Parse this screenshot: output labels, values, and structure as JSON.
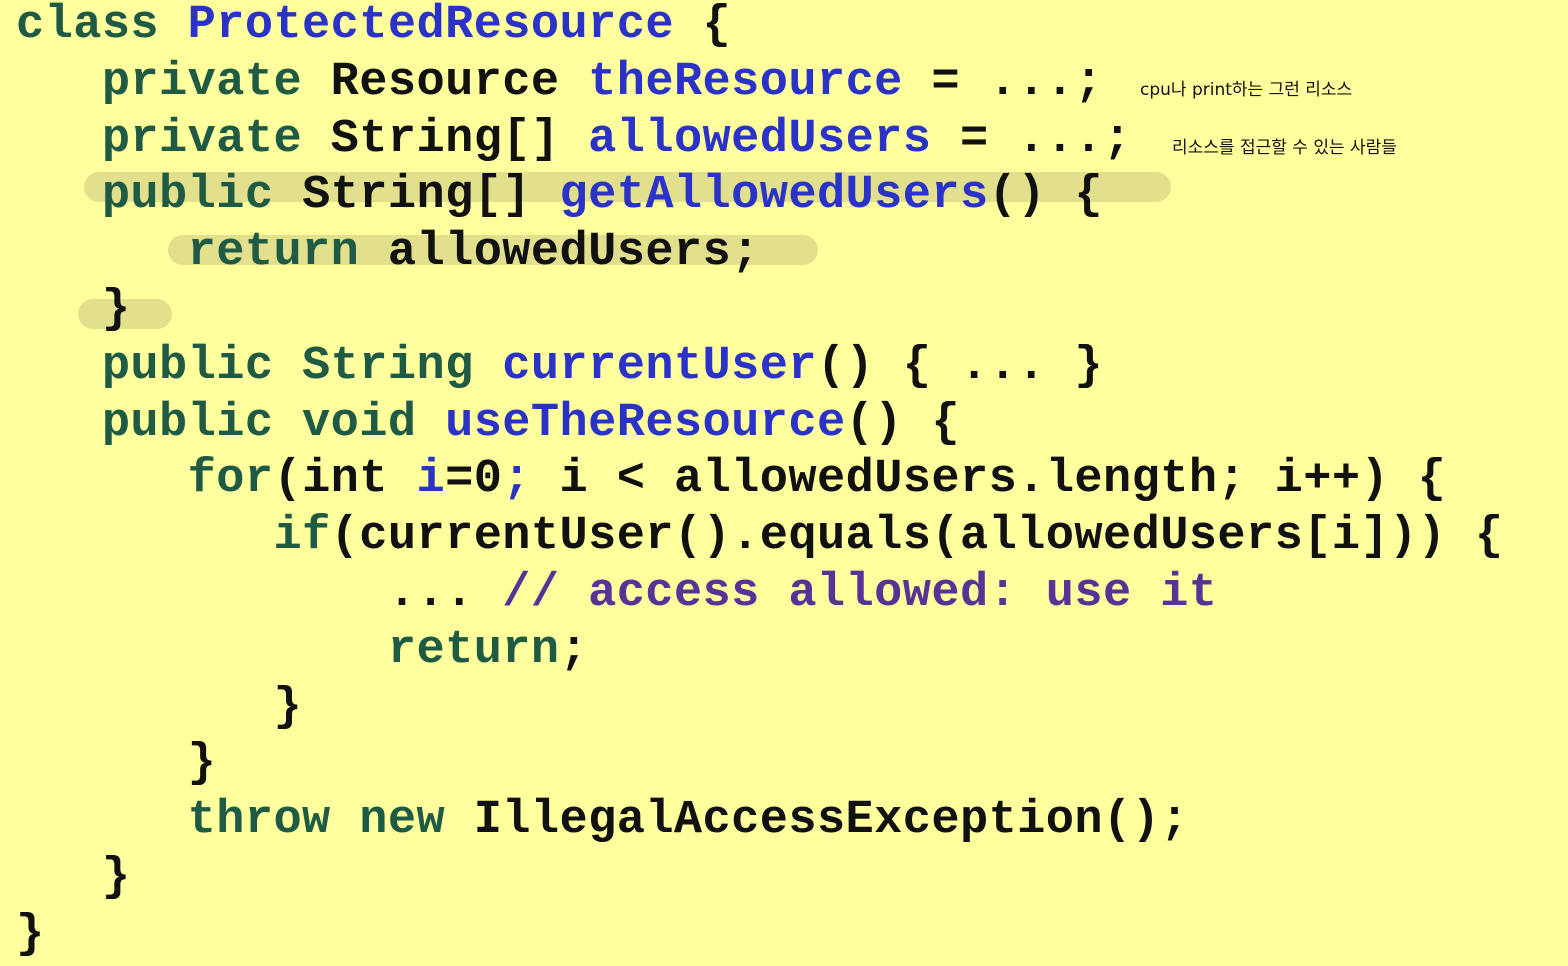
{
  "colors": {
    "background": "#ffff9e",
    "highlight": "#e2e08c",
    "keyword": "#1f5a45",
    "plain": "#111111",
    "identifier": "#2a32c8",
    "comment": "#5a3296"
  },
  "lines": [
    {
      "name": "line-class-decl",
      "tokens": [
        {
          "text": "class ",
          "kind": "keyword"
        },
        {
          "text": "ProtectedResource",
          "kind": "identifier"
        },
        {
          "text": " {",
          "kind": "plain"
        }
      ]
    },
    {
      "name": "line-field-resource",
      "tokens": [
        {
          "text": "   ",
          "kind": "plain"
        },
        {
          "text": "private ",
          "kind": "keyword"
        },
        {
          "text": "Resource ",
          "kind": "plain"
        },
        {
          "text": "theResource",
          "kind": "identifier"
        },
        {
          "text": " = ...;",
          "kind": "plain"
        }
      ]
    },
    {
      "name": "line-field-allowed-users",
      "tokens": [
        {
          "text": "   ",
          "kind": "plain"
        },
        {
          "text": "private ",
          "kind": "keyword"
        },
        {
          "text": "String[] ",
          "kind": "plain"
        },
        {
          "text": "allowedUsers",
          "kind": "identifier"
        },
        {
          "text": " = ...;",
          "kind": "plain"
        }
      ]
    },
    {
      "name": "line-method-get-allowed-users",
      "tokens": [
        {
          "text": "   ",
          "kind": "plain"
        },
        {
          "text": "public ",
          "kind": "keyword"
        },
        {
          "text": "String[] ",
          "kind": "plain"
        },
        {
          "text": "getAllowedUsers",
          "kind": "identifier"
        },
        {
          "text": "() {",
          "kind": "plain"
        }
      ]
    },
    {
      "name": "line-return-allowed-users",
      "tokens": [
        {
          "text": "      ",
          "kind": "plain"
        },
        {
          "text": "return ",
          "kind": "keyword"
        },
        {
          "text": "allowedUsers;",
          "kind": "plain"
        }
      ]
    },
    {
      "name": "line-close-get-allowed-users",
      "tokens": [
        {
          "text": "   }",
          "kind": "plain"
        }
      ]
    },
    {
      "name": "line-method-current-user",
      "tokens": [
        {
          "text": "   ",
          "kind": "plain"
        },
        {
          "text": "public String ",
          "kind": "keyword"
        },
        {
          "text": "currentUser",
          "kind": "identifier"
        },
        {
          "text": "() { ... }",
          "kind": "plain"
        }
      ]
    },
    {
      "name": "line-method-use-the-resource",
      "tokens": [
        {
          "text": "   ",
          "kind": "plain"
        },
        {
          "text": "public void ",
          "kind": "keyword"
        },
        {
          "text": "useTheResource",
          "kind": "identifier"
        },
        {
          "text": "() {",
          "kind": "plain"
        }
      ]
    },
    {
      "name": "line-for-loop",
      "tokens": [
        {
          "text": "      ",
          "kind": "plain"
        },
        {
          "text": "for",
          "kind": "keyword"
        },
        {
          "text": "(int ",
          "kind": "plain"
        },
        {
          "text": "i",
          "kind": "identifier"
        },
        {
          "text": "=0",
          "kind": "plain"
        },
        {
          "text": ";",
          "kind": "identifier"
        },
        {
          "text": " i < allowedUsers.length; i++) {",
          "kind": "plain"
        }
      ]
    },
    {
      "name": "line-if-current-user",
      "tokens": [
        {
          "text": "         ",
          "kind": "plain"
        },
        {
          "text": "if",
          "kind": "keyword"
        },
        {
          "text": "(currentUser().equals(allowedUsers[i])) {",
          "kind": "plain"
        }
      ]
    },
    {
      "name": "line-access-allowed-comment",
      "tokens": [
        {
          "text": "             ... ",
          "kind": "plain"
        },
        {
          "text": "// access allowed: use it",
          "kind": "comment"
        }
      ]
    },
    {
      "name": "line-return",
      "tokens": [
        {
          "text": "             ",
          "kind": "plain"
        },
        {
          "text": "return",
          "kind": "keyword"
        },
        {
          "text": ";",
          "kind": "plain"
        }
      ]
    },
    {
      "name": "line-close-if",
      "tokens": [
        {
          "text": "         }",
          "kind": "plain"
        }
      ]
    },
    {
      "name": "line-close-for",
      "tokens": [
        {
          "text": "      }",
          "kind": "plain"
        }
      ]
    },
    {
      "name": "line-throw",
      "tokens": [
        {
          "text": "      ",
          "kind": "plain"
        },
        {
          "text": "throw new ",
          "kind": "keyword"
        },
        {
          "text": "IllegalAccessException();",
          "kind": "plain"
        }
      ]
    },
    {
      "name": "line-close-use-the-resource",
      "tokens": [
        {
          "text": "   }",
          "kind": "plain"
        }
      ]
    },
    {
      "name": "line-close-class",
      "tokens": [
        {
          "text": "}",
          "kind": "plain"
        }
      ]
    }
  ],
  "notes": {
    "resource_note": "cpu나 print하는 그런 리소스",
    "users_note": "리소스를 접근할 수 있는 사람들"
  }
}
